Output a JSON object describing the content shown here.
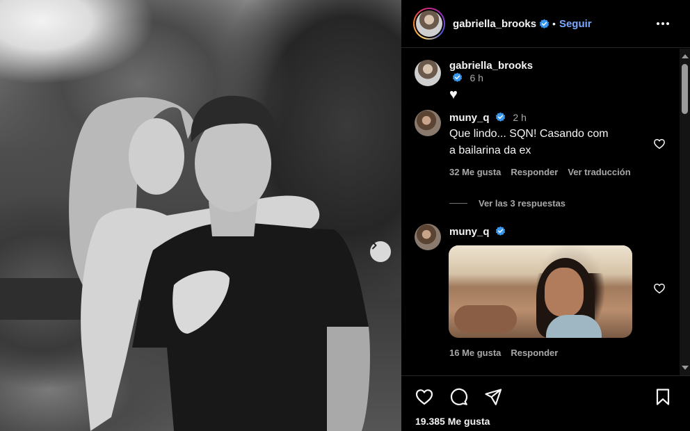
{
  "post": {
    "author": "gabriella_brooks",
    "follow_label": "Seguir",
    "likes_text": "19.385 Me gusta"
  },
  "caption": {
    "username": "gabriella_brooks",
    "time": "6 h",
    "text": "♥"
  },
  "comments": [
    {
      "username": "muny_q",
      "time": "2 h",
      "text_line1": "Que lindo... SQN! Casando com",
      "text_line2": "a bailarina da ex",
      "likes": "32 Me gusta",
      "reply": "Responder",
      "translate": "Ver traducción",
      "view_replies": "Ver las 3 respuestas"
    },
    {
      "username": "muny_q",
      "likes": "16 Me gusta",
      "reply": "Responder"
    }
  ],
  "icons": {
    "verified": "verified-badge-icon",
    "more": "more-options-icon",
    "next": "chevron-right-icon",
    "like": "heart-icon",
    "comment": "comment-icon",
    "share": "send-icon",
    "save": "bookmark-icon"
  },
  "colors": {
    "background": "#000000",
    "follow": "#7aa9ff",
    "verified": "#3897f0",
    "muted": "#a8a8a8"
  }
}
